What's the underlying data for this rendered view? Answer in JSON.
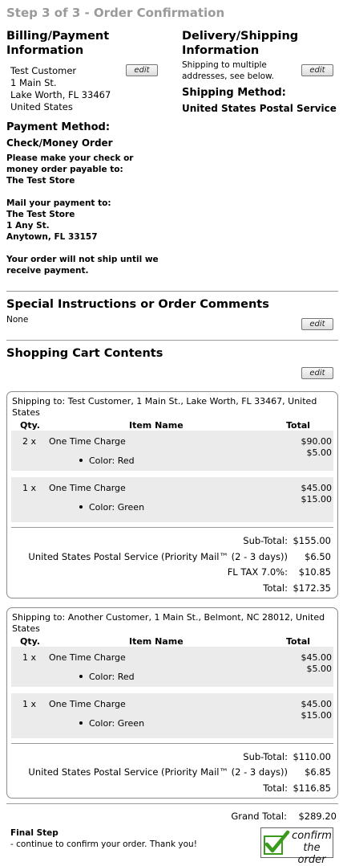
{
  "page_title": "Step 3 of 3 - Order Confirmation",
  "billing": {
    "heading": "Billing/Payment Information",
    "address": [
      "Test Customer",
      "1 Main St.",
      "Lake Worth, FL 33467",
      "United States"
    ],
    "edit_label": "edit"
  },
  "payment": {
    "heading": "Payment Method:",
    "method": "Check/Money Order",
    "instructions": [
      "Please make your check or",
      "money order payable to:",
      "The Test Store",
      "",
      "Mail your payment to:",
      "The Test Store",
      "1 Any St.",
      "Anytown, FL 33157",
      "",
      "Your order will not ship until we",
      "receive payment."
    ]
  },
  "delivery": {
    "heading": "Delivery/Shipping Information",
    "note_line1": "Shipping to multiple",
    "note_line2": "addresses, see below.",
    "edit_label": "edit",
    "method_heading": "Shipping Method:",
    "method": "United States Postal Service"
  },
  "comments": {
    "heading": "Special Instructions or Order Comments",
    "value": "None",
    "edit_label": "edit"
  },
  "cart": {
    "heading": "Shopping Cart Contents",
    "edit_label": "edit",
    "col_qty": "Qty.",
    "col_item": "Item Name",
    "col_total": "Total",
    "shipments": [
      {
        "ship_to": "Shipping to: Test Customer, 1 Main St., Lake Worth, FL 33467, United States",
        "items": [
          {
            "qty": "2 x",
            "name": "One Time Charge",
            "attribute": "Color: Red",
            "total": "$90.00",
            "extra": "$5.00"
          },
          {
            "qty": "1 x",
            "name": "One Time Charge",
            "attribute": "Color: Green",
            "total": "$45.00",
            "extra": "$15.00"
          }
        ],
        "summary": [
          {
            "label": "Sub-Total:",
            "value": "$155.00"
          },
          {
            "label": "United States Postal Service (Priority Mail™ (2 - 3 days))",
            "value": "$6.50"
          },
          {
            "label": "FL TAX 7.0%:",
            "value": "$10.85"
          },
          {
            "label": "Total:",
            "value": "$172.35"
          }
        ]
      },
      {
        "ship_to": "Shipping to: Another Customer, 1 Main St., Belmont, NC 28012, United States",
        "items": [
          {
            "qty": "1 x",
            "name": "One Time Charge",
            "attribute": "Color: Red",
            "total": "$45.00",
            "extra": "$5.00"
          },
          {
            "qty": "1 x",
            "name": "One Time Charge",
            "attribute": "Color: Green",
            "total": "$45.00",
            "extra": "$15.00"
          }
        ],
        "summary": [
          {
            "label": "Sub-Total:",
            "value": "$110.00"
          },
          {
            "label": "United States Postal Service (Priority Mail™ (2 - 3 days))",
            "value": "$6.85"
          },
          {
            "label": "Total:",
            "value": "$116.85"
          }
        ]
      }
    ]
  },
  "grand_total": {
    "label": "Grand Total:",
    "value": "$289.20"
  },
  "final_step": {
    "heading": "Final Step",
    "text": "- continue to confirm your order. Thank you!",
    "button_line1": "confirm",
    "button_line2": "the order"
  },
  "colors": {
    "title_gray": "#9a9a9a",
    "item_bg": "#ebebeb",
    "check_green": "#3a9a1e"
  },
  "icons": {
    "confirm_button_icon": "checkmark-icon"
  }
}
